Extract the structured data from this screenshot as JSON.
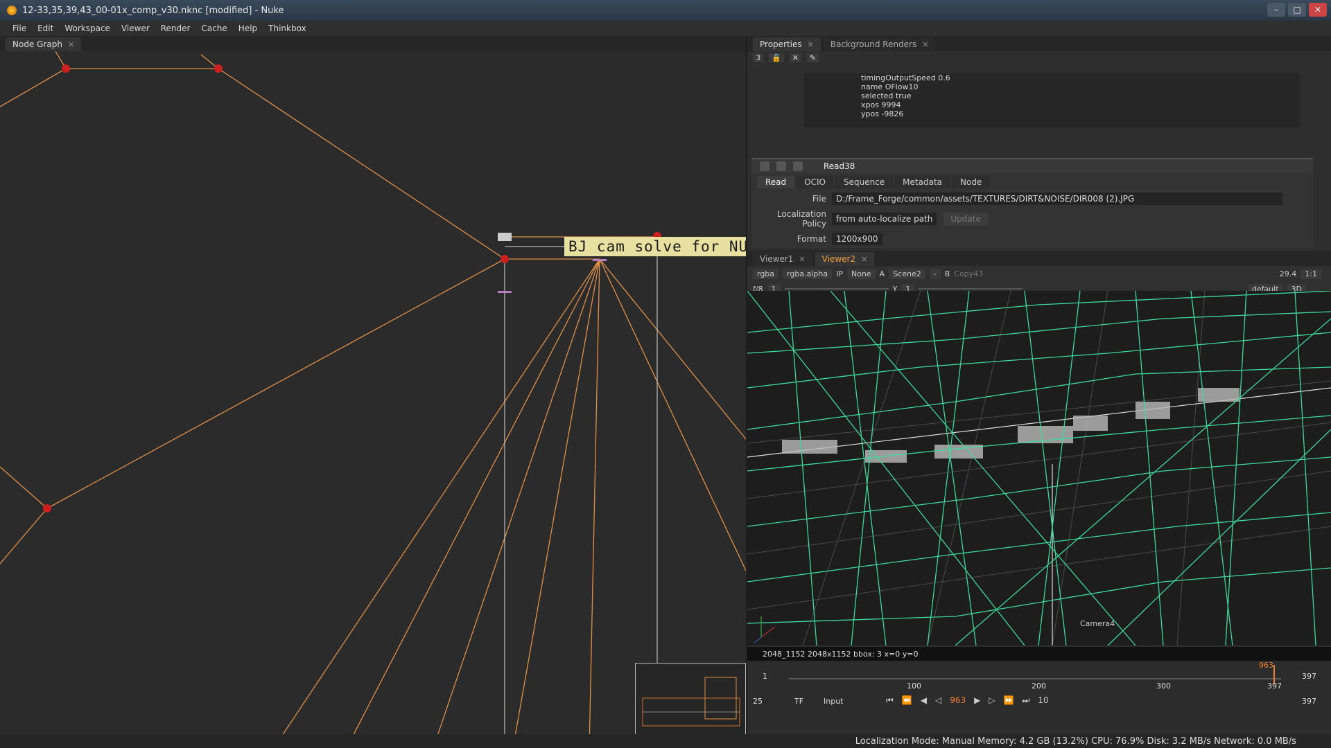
{
  "window": {
    "title": "12-33,35,39,43_00-01x_comp_v30.nknc [modified] - Nuke",
    "buttons": [
      "–",
      "□",
      "✕"
    ]
  },
  "menu": [
    "File",
    "Edit",
    "Workspace",
    "Viewer",
    "Render",
    "Cache",
    "Help",
    "Thinkbox"
  ],
  "node_graph": {
    "tab_label": "Node Graph",
    "sticky_note": "BJ cam solve for NUKE"
  },
  "properties": {
    "tabs": [
      "Properties",
      "Background Renders"
    ],
    "count": "3",
    "script_lines": [
      "timingOutputSpeed 0.6",
      "name OFlow10",
      "selected true",
      "xpos 9994",
      "ypos -9826"
    ],
    "node_name": "Read38",
    "node_tabs": [
      "Read",
      "OCIO",
      "Sequence",
      "Metadata",
      "Node"
    ],
    "file_label": "File",
    "file_value": "D:/Frame_Forge/common/assets/TEXTURES/DIRT&NOISE/DIR008 (2).JPG",
    "localization_label": "Localization Policy",
    "localization_value": "from auto-localize path",
    "update_button": "Update",
    "format_label": "Format",
    "format_value": "1200x900"
  },
  "viewer": {
    "tabs": [
      "Viewer1",
      "Viewer2"
    ],
    "channels": "rgba",
    "alpha": "rgba.alpha",
    "ip": "IP",
    "none": "None",
    "a_label": "A",
    "a_input": "Scene2",
    "dash": "-",
    "b_label": "B",
    "b_input": "Copy43",
    "fps_display": "29.4",
    "zoom": "1:1",
    "fstop": "f/8",
    "gain": "1",
    "y_label": "Y",
    "gamma": "1",
    "lut": "default",
    "mode": "3D",
    "camera_label": "Camera4",
    "info": "2048_1152 2048x1152  bbox: 3  x=0 y=0"
  },
  "timeline": {
    "start": "1",
    "ticks": [
      "100",
      "200",
      "300"
    ],
    "current_marker": "963",
    "end_marker": "397",
    "end": "397",
    "fps": "25",
    "tf": "TF",
    "input": "Input",
    "current_frame": "963",
    "step": "10",
    "end_field": "397"
  },
  "status": "Localization Mode: Manual Memory: 4.2 GB (13.2%) CPU: 76.9% Disk: 3.2 MB/s Network: 0.0 MB/s",
  "colors": {
    "wireframe": "#3fd9a0",
    "node_line": "#e0904a",
    "dot": "#cc2020",
    "sticky": "#e8e0a0"
  }
}
